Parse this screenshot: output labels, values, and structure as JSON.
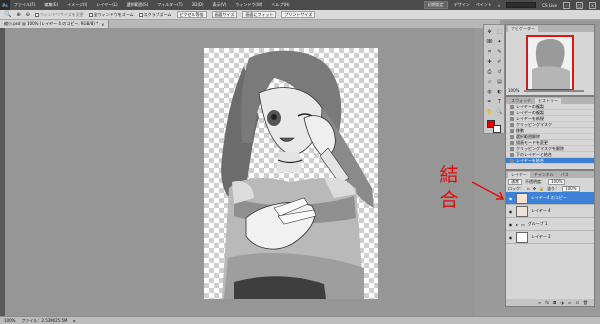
{
  "app": {
    "logo": "Ps"
  },
  "menu": {
    "items": [
      "ファイル(F)",
      "編集(E)",
      "イメージ(I)",
      "レイヤー(L)",
      "選択範囲(S)",
      "フィルター(T)",
      "3D(D)",
      "表示(V)",
      "ウィンドウ(W)",
      "ヘルプ(H)"
    ],
    "workspace": "初期設定",
    "design": "デザイン",
    "painting": "ペイント",
    "cs_live": "CS Live"
  },
  "options": {
    "resize_window": "ウィンドウサイズを変更",
    "zoom_all": "全ウィンドウをズーム",
    "scrubby_zoom": "スクラブズーム",
    "actual_pixels": "ピクセル等倍",
    "fit_screen": "画面サイズ",
    "fill_screen": "画面にフィット",
    "print_size": "プリントサイズ"
  },
  "document": {
    "tab_title": "縮小.psd @ 100% (レイヤー 4 のコピー, RGB/8) *"
  },
  "status": {
    "zoom": "100%",
    "file_info": "ファイル：2.53M/25.5M"
  },
  "navigator": {
    "tabs": [
      "ナビゲーター"
    ],
    "zoom": "100%"
  },
  "history": {
    "tabs": [
      "スウォッチ",
      "ヒストリー"
    ],
    "rows": [
      "レイヤーの複製",
      "レイヤーの複製",
      "レイヤーを新規",
      "クリッピングマスク",
      "移動",
      "選択範囲解除",
      "描画モードを変更",
      "クリッピングマスクを解除",
      "下のレイヤーと結合",
      "レイヤーを結合"
    ]
  },
  "layers": {
    "tabs": [
      "レイヤー",
      "チャンネル",
      "パス"
    ],
    "blend_mode": "通常",
    "opacity_label": "不透明度：",
    "opacity_value": "100%",
    "lock_label": "ロック：",
    "fill_label": "塗り：",
    "fill_value": "100%",
    "rows": [
      "レイヤー4 のコピー",
      "レイヤー 4",
      "グループ 1",
      "レイヤー 2"
    ]
  },
  "annotation": {
    "text": "結合",
    "color": "#e60c0c"
  },
  "colors": {
    "foreground": "#e60000",
    "background": "#ffffff",
    "selection": "#3d82d7"
  }
}
